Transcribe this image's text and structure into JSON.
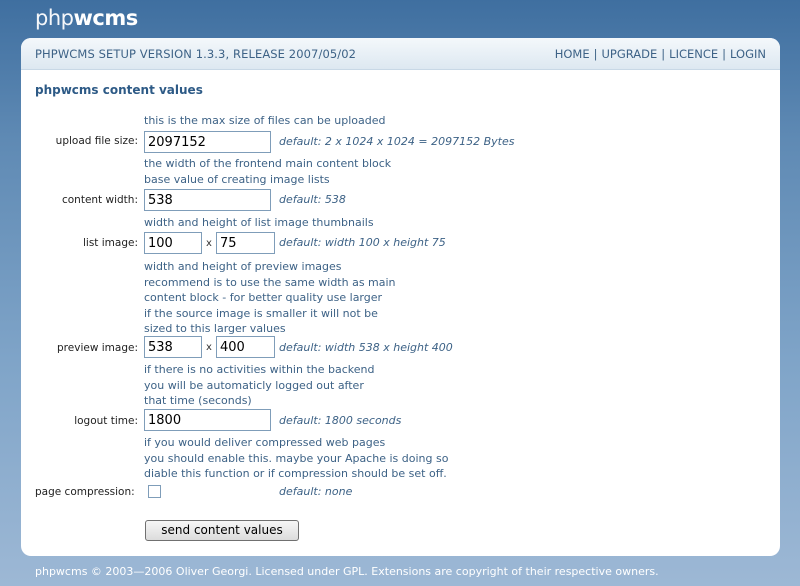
{
  "logo": {
    "part1": "php",
    "part2": "wcms"
  },
  "header": {
    "version": "PHPWCMS SETUP VERSION 1.3.3, RELEASE 2007/05/02",
    "links": [
      "HOME",
      "UPGRADE",
      "LICENCE",
      "LOGIN"
    ],
    "separator": "|"
  },
  "page_title": "phpwcms content values",
  "upload": {
    "help": [
      "this is the max size of files can be uploaded"
    ],
    "label": "upload file size:",
    "value": "2097152",
    "default": "default: 2 x 1024 x 1024 = 2097152 Bytes"
  },
  "content_width": {
    "help": [
      "the width of the frontend main content block",
      "base value of creating image lists"
    ],
    "label": "content width:",
    "value": "538",
    "default": "default: 538"
  },
  "list_image": {
    "help": [
      "width and height of list image thumbnails"
    ],
    "label": "list image:",
    "width": "100",
    "height": "75",
    "x": "x",
    "default": "default: width 100 x height 75"
  },
  "preview_image": {
    "help": [
      "width and height of preview images",
      "recommend is to use the same width as main",
      "content block - for better quality use larger",
      "if the source image is smaller it will not be",
      "sized to this larger values"
    ],
    "label": "preview image:",
    "width": "538",
    "height": "400",
    "x": "x",
    "default": "default: width 538 x height 400"
  },
  "logout": {
    "help": [
      "if there is no activities within the backend",
      "you will be automaticly logged out after",
      "that time (seconds)"
    ],
    "label": "logout time:",
    "value": "1800",
    "default": "default: 1800 seconds"
  },
  "compression": {
    "help": [
      "if you would deliver compressed web pages",
      "you should enable this. maybe your Apache is doing so",
      "diable this function or if compression should be set off."
    ],
    "label": "page compression:",
    "checked": false,
    "default": "default: none"
  },
  "submit_label": "send content values",
  "footer": "phpwcms © 2003—2006 Oliver Georgi. Licensed under GPL. Extensions are copyright of their respective owners."
}
